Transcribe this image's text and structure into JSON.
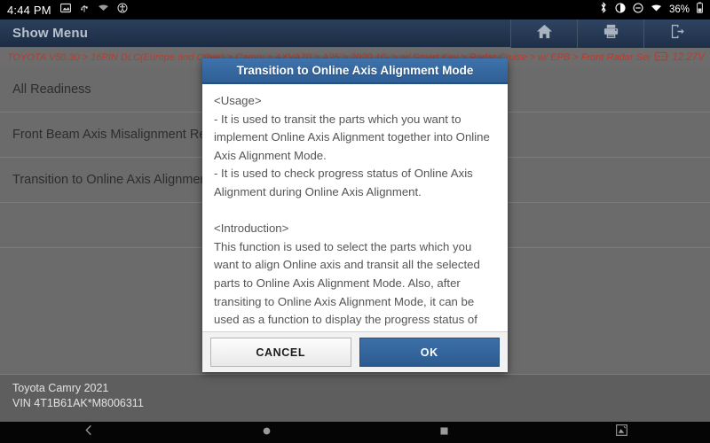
{
  "statusbar": {
    "time": "4:44 PM",
    "left_icons": [
      "screenshot-icon",
      "usb-icon",
      "cast-icon",
      "accessibility-icon"
    ],
    "right_icons": [
      "bluetooth-icon",
      "brightness-icon",
      "do-not-disturb-icon",
      "wifi-icon"
    ],
    "battery_percent": "36%",
    "battery_icon": "battery-icon"
  },
  "header": {
    "title": "Show Menu",
    "buttons": [
      {
        "name": "home-button",
        "icon": "home-icon"
      },
      {
        "name": "print-button",
        "icon": "printer-icon"
      },
      {
        "name": "exit-button",
        "icon": "exit-icon"
      }
    ]
  },
  "breadcrumb": {
    "path": "TOYOTA V50.30 > 16PIN DLC(Europe and Other) > Camry > AXVA70 > A25  > 2020.10- > w/ Smart Key > Radar Cruise > w/ EPB > Front Radar Sensor",
    "battery_icon": "battery-voltage-icon",
    "voltage": "12.27V"
  },
  "menu": {
    "items": [
      "All Readiness",
      "Front Beam Axis Misalignment Reading / Sensor Calibration",
      "Transition to Online Axis Alignment"
    ]
  },
  "footer": {
    "vehicle": "Toyota Camry 2021",
    "vin": "VIN 4T1B61AK*M8006311"
  },
  "navbar": {
    "items": [
      {
        "name": "nav-back-button",
        "icon": "chevron-left-icon"
      },
      {
        "name": "nav-home-button",
        "icon": "circle-icon"
      },
      {
        "name": "nav-recents-button",
        "icon": "square-icon"
      },
      {
        "name": "nav-screenshot-button",
        "icon": "screenshot-icon"
      }
    ]
  },
  "dialog": {
    "title": "Transition to Online Axis Alignment Mode",
    "body": "<Usage>\n- It is used to transit the parts which you want to implement Online Axis Alignment together into Online Axis Alignment Mode.\n- It is used to check progress status of Online Axis Alignment during Online Axis Alignment.\n\n<Introduction>\nThis function is used to select the parts which you want to align Online axis and transit all the selected parts to Online Axis Alignment Mode. Also, after transiting to Online Axis Alignment Mode, it can be used as a function to display the progress status of Online Axis Alignment.",
    "cancel_label": "CANCEL",
    "ok_label": "OK"
  },
  "colors": {
    "header_blue": "#2b3f5c",
    "dialog_blue": "#3f72ab",
    "breadcrumb_red": "#b83c2e",
    "content_gray": "#6b6b6b"
  }
}
